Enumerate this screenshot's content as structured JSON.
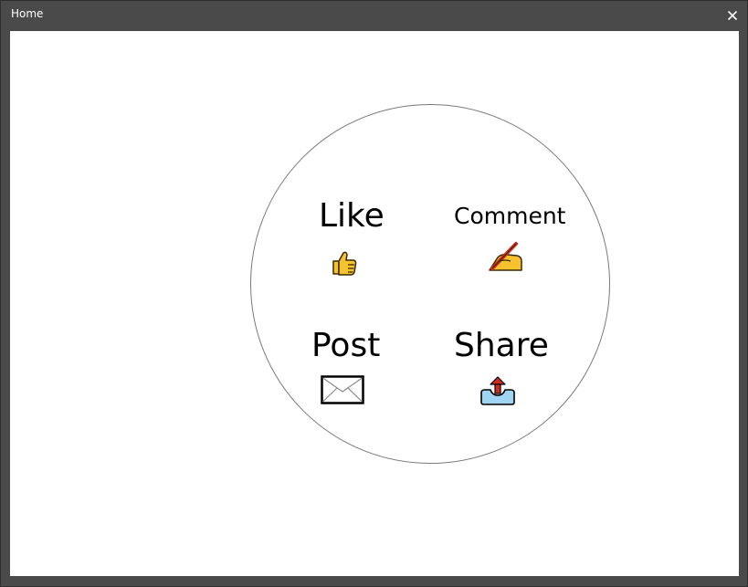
{
  "window": {
    "title": "Home"
  },
  "menu": {
    "items": [
      {
        "label": "Like",
        "icon": "thumbs-up-icon"
      },
      {
        "label": "Comment",
        "icon": "writing-hand-icon"
      },
      {
        "label": "Post",
        "icon": "envelope-icon"
      },
      {
        "label": "Share",
        "icon": "outbox-tray-icon"
      }
    ]
  },
  "colors": {
    "titlebar": "#4a4a4a",
    "content_bg": "#ffffff",
    "circle_border": "#7a7a7a",
    "icon_yellow": "#f7c22f",
    "icon_red": "#d02b1f",
    "icon_blue": "#9fd4f2"
  }
}
